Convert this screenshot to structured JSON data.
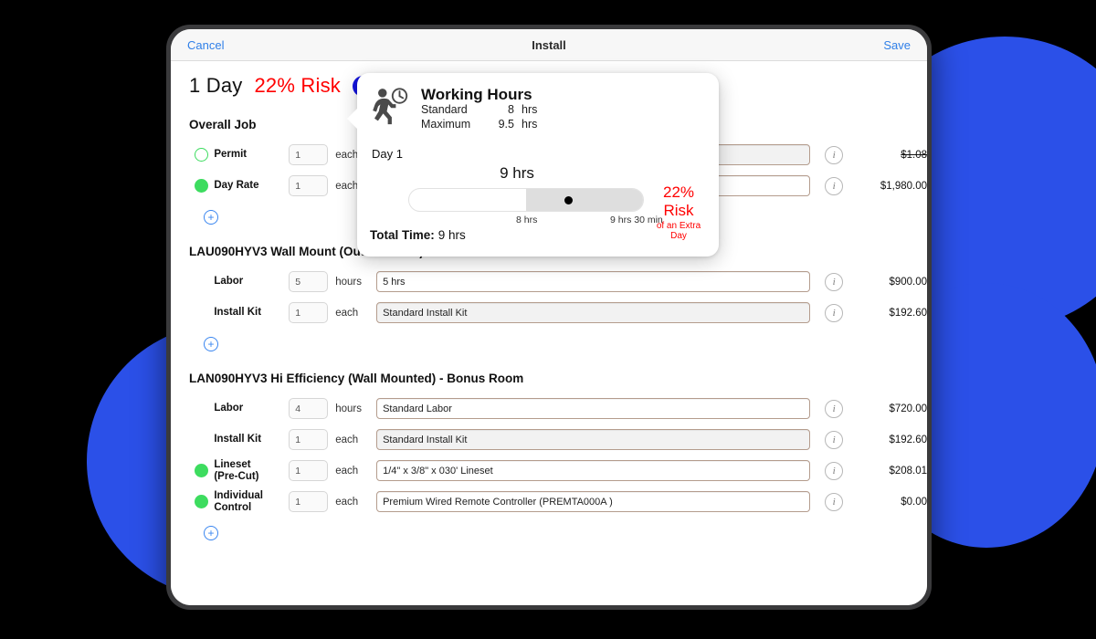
{
  "navbar": {
    "cancel_label": "Cancel",
    "title": "Install",
    "save_label": "Save"
  },
  "summary": {
    "days": "1 Day",
    "risk": "22% Risk",
    "info_badge": "i"
  },
  "popover": {
    "icon_name": "walking-person-with-clock-icon",
    "title": "Working Hours",
    "standard_label": "Standard",
    "standard_value": "8",
    "standard_unit": "hrs",
    "maximum_label": "Maximum",
    "maximum_value": "9.5",
    "maximum_unit": "hrs",
    "day_label": "Day 1",
    "slider_value": "9 hrs",
    "tick_low": "8 hrs",
    "tick_high": "9 hrs 30 min",
    "risk_big": "22% Risk",
    "risk_sub": "of an Extra Day",
    "total_label": "Total Time:",
    "total_value": "9 hrs",
    "risk_color": "#ff0000"
  },
  "groups": [
    {
      "title": "Overall Job",
      "add_label": "+",
      "rows": [
        {
          "dot": "hollow",
          "label": "Permit",
          "qty": "1",
          "unit": "each",
          "desc": "",
          "desc_shaded": true,
          "info": "i",
          "price": "$1.08",
          "struck": true
        },
        {
          "dot": "filled",
          "label": "Day Rate",
          "qty": "1",
          "unit": "each",
          "desc": "",
          "desc_shaded": false,
          "info": "i",
          "price": "$1,980.00",
          "struck": false
        }
      ]
    },
    {
      "title": "LAU090HYV3 Wall Mount (Outdoor Unit)",
      "add_label": "+",
      "rows": [
        {
          "dot": "none",
          "label": "Labor",
          "qty": "5",
          "unit": "hours",
          "desc": "5 hrs",
          "desc_shaded": false,
          "info": "i",
          "price": "$900.00",
          "struck": false
        },
        {
          "dot": "none",
          "label": "Install Kit",
          "qty": "1",
          "unit": "each",
          "desc": "Standard Install Kit",
          "desc_shaded": true,
          "info": "i",
          "price": "$192.60",
          "struck": false
        }
      ]
    },
    {
      "title": "LAN090HYV3 Hi Efficiency  (Wall Mounted) - Bonus Room",
      "add_label": "+",
      "rows": [
        {
          "dot": "none",
          "label": "Labor",
          "qty": "4",
          "unit": "hours",
          "desc": "Standard Labor",
          "desc_shaded": false,
          "info": "i",
          "price": "$720.00",
          "struck": false
        },
        {
          "dot": "none",
          "label": "Install Kit",
          "qty": "1",
          "unit": "each",
          "desc": "Standard Install Kit",
          "desc_shaded": true,
          "info": "i",
          "price": "$192.60",
          "struck": false
        },
        {
          "dot": "filled",
          "label": "Lineset\n(Pre-Cut)",
          "qty": "1",
          "unit": "each",
          "desc": "1/4\" x 3/8\" x 030' Lineset",
          "desc_shaded": false,
          "info": "i",
          "price": "$208.01",
          "struck": false
        },
        {
          "dot": "filled",
          "label": "Individual\nControl",
          "qty": "1",
          "unit": "each",
          "desc": "Premium Wired Remote Controller (PREMTA000A )",
          "desc_shaded": false,
          "info": "i",
          "price": "$0.00",
          "struck": false
        }
      ]
    }
  ],
  "theme": {
    "background": "#000000",
    "blob_blue": "#2B50E8",
    "accent_blue": "#2f7fe8",
    "badge_blue": "#1414e0",
    "green": "#3ddc5f",
    "risk_red": "#ff0000"
  }
}
